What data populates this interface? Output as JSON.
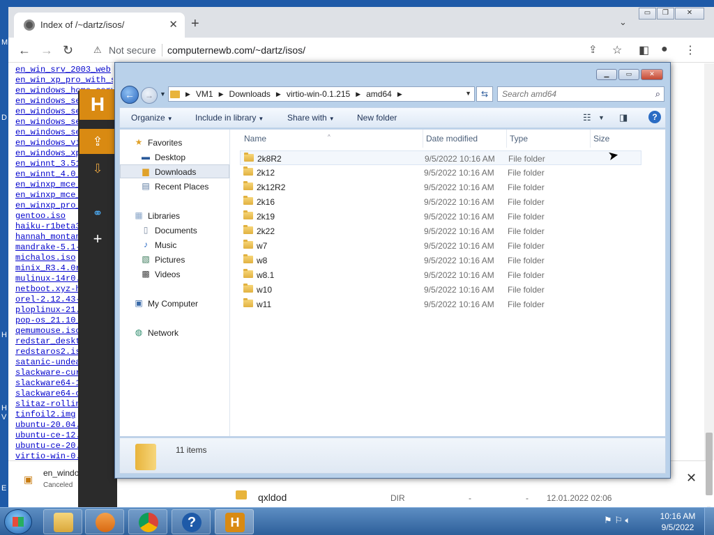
{
  "desktop_letters": [
    "M",
    "D",
    "H",
    "H",
    "V",
    "E"
  ],
  "browser": {
    "tab_title": "Index of /~dartz/isos/",
    "not_secure": "Not secure",
    "url": "computernewb.com/~dartz/isos/",
    "files": [
      "en_win_srv_2003_web",
      "en_win_xp_pro_with_s",
      "en_windows_home_serv",
      "en_windows_se",
      "en_windows_se",
      "en_windows_se",
      "en_windows_se",
      "en_windows_vi",
      "en_windows_xp",
      "en_winnt_3.51",
      "en_winnt_4.0_",
      "en_winxp_mce_",
      "en_winxp_mce_",
      "en_winxp_pro_",
      "gentoo.iso",
      "haiku-r1beta3",
      "hannah_montan",
      "mandrake-5.1-",
      "michalos.iso",
      "minix_R3.4.0r",
      "mulinux-14r0.",
      "netboot.xyz-h",
      "orel-2.12.43-",
      "ploplinux-21.",
      "pop-os_21.10_",
      "qemumouse.iso",
      "redstar_deskt",
      "redstaros2.is",
      "satanic-undea",
      "slackware-cur",
      "slackware64-1",
      "slackware64-c",
      "slitaz-rollin",
      "tinfoil2.img",
      "ubuntu-20.04.",
      "ubuntu-ce-12.",
      "ubuntu-ce-20.",
      "virtio-win-0."
    ],
    "listing_row": {
      "name": "qxldod",
      "type": "DIR",
      "size": "-",
      "extra": "-",
      "date": "12.01.2022 02:06"
    },
    "download": {
      "name": "en_windo",
      "status": "Canceled"
    }
  },
  "explorer": {
    "breadcrumbs": [
      "VM1",
      "Downloads",
      "virtio-win-0.1.215",
      "amd64"
    ],
    "search_placeholder": "Search amd64",
    "toolbar": {
      "organize": "Organize",
      "include": "Include in library",
      "share": "Share with",
      "new_folder": "New folder"
    },
    "nav": {
      "favorites": "Favorites",
      "desktop": "Desktop",
      "downloads": "Downloads",
      "recent": "Recent Places",
      "libraries": "Libraries",
      "documents": "Documents",
      "music": "Music",
      "pictures": "Pictures",
      "videos": "Videos",
      "computer": "My Computer",
      "network": "Network"
    },
    "columns": {
      "name": "Name",
      "date": "Date modified",
      "type": "Type",
      "size": "Size"
    },
    "rows": [
      {
        "name": "2k8R2",
        "date": "9/5/2022 10:16 AM",
        "type": "File folder"
      },
      {
        "name": "2k12",
        "date": "9/5/2022 10:16 AM",
        "type": "File folder"
      },
      {
        "name": "2k12R2",
        "date": "9/5/2022 10:16 AM",
        "type": "File folder"
      },
      {
        "name": "2k16",
        "date": "9/5/2022 10:16 AM",
        "type": "File folder"
      },
      {
        "name": "2k19",
        "date": "9/5/2022 10:16 AM",
        "type": "File folder"
      },
      {
        "name": "2k22",
        "date": "9/5/2022 10:16 AM",
        "type": "File folder"
      },
      {
        "name": "w7",
        "date": "9/5/2022 10:16 AM",
        "type": "File folder"
      },
      {
        "name": "w8",
        "date": "9/5/2022 10:16 AM",
        "type": "File folder"
      },
      {
        "name": "w8.1",
        "date": "9/5/2022 10:16 AM",
        "type": "File folder"
      },
      {
        "name": "w10",
        "date": "9/5/2022 10:16 AM",
        "type": "File folder"
      },
      {
        "name": "w11",
        "date": "9/5/2022 10:16 AM",
        "type": "File folder"
      }
    ],
    "status": "11 items"
  },
  "app_logo": "H",
  "taskbar": {
    "time": "10:16 AM",
    "date": "9/5/2022",
    "h_label": "H"
  }
}
